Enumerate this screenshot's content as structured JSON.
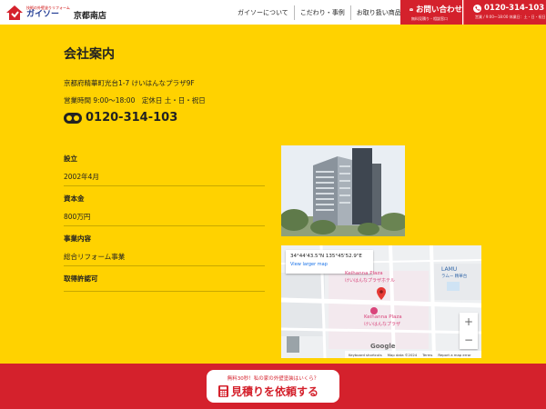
{
  "header": {
    "logo_tagline": "技術の外壁塗りリフォーム",
    "logo_brand": "ガイソー",
    "logo_branch": "京都南店",
    "nav": [
      "ガイソーについて",
      "こだわり・事例",
      "お取り扱い商品"
    ],
    "contact_label": "お問い合わせ",
    "contact_sub": "無料見積り・相談窓口",
    "tel_label": "0120-314-103",
    "tel_sub": "営業 / 9:00〜18:00 休業日：土・日・祝日"
  },
  "main": {
    "title": "会社案内",
    "address": "京都府精華町光台1-7 けいはんなプラザ9F",
    "hours": "営業時間 9:00〜18:00　定休日 土・日・祝日",
    "tel": "0120-314-103",
    "info": [
      {
        "label": "設立",
        "value": "2002年4月"
      },
      {
        "label": "資本金",
        "value": "800万円"
      },
      {
        "label": "事業内容",
        "value": "総合リフォーム事業"
      },
      {
        "label": "取得許認可",
        "value": ""
      }
    ]
  },
  "map": {
    "coord": "34°44'43.5\"N 135°45'52.9\"E",
    "link": "View larger map",
    "place_ja_1": "けいはんなプラザホテル",
    "place_en_1": "Keihanna Plaza",
    "place_en_2": "Keihanna Plaza",
    "place_ja_2": "けいはんなプラザ",
    "lamu": "LAMU",
    "lamu_sub": "ラムー 精華台",
    "zoom_in": "+",
    "zoom_out": "−",
    "google": "Google",
    "footer": [
      "Keyboard shortcuts",
      "Map data ©2024",
      "Terms",
      "Report a map error"
    ]
  },
  "cta": {
    "sub": "無料30秒！私の家の外壁塗装はいくら？",
    "main": "見積りを依頼する"
  },
  "colors": {
    "background": "#ffd200",
    "accent_red": "#d4212c",
    "brand_blue": "#1f3a93"
  }
}
